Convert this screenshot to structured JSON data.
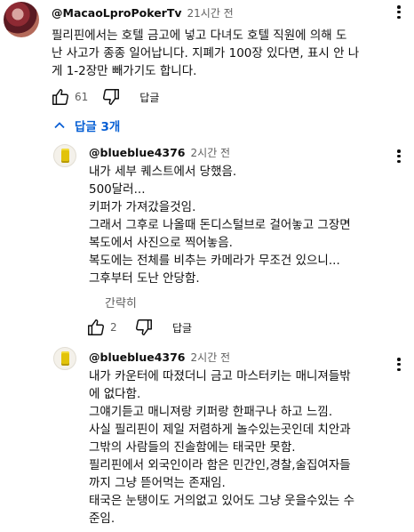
{
  "main_comment": {
    "author": "@MacaoLproPokerTv",
    "time": "21시간 전",
    "text": "필리핀에서는 호텔 금고에 넣고 다녀도 호텔 직원에 의해 도\n난 사고가 종종 일어납니다. 지폐가 100장 있다면, 표시 안 나\n게 1-2장만 빼가기도 합니다.",
    "likes": "61",
    "reply_label": "답글",
    "replies_toggle": "답글 3개"
  },
  "replies": [
    {
      "author": "@blueblue4376",
      "time": "2시간 전",
      "text": "내가 세부 퀘스트에서 당했음.\n500달러...\n키퍼가 가져갔을것임.\n그래서 그후로 나올때 돈디스털브로 걸어놓고 그장면\n복도에서 사진으로 찍어놓음.\n복도에는 전체를 비추는 카메라가 무조건 있으니...\n그후부터 도난 안당함.",
      "show_less": "간략히",
      "likes": "2",
      "reply_label": "답글"
    },
    {
      "author": "@blueblue4376",
      "time": "2시간 전",
      "text": "내가 카운터에 따졌더니 금고 마스터키는 매니져들밖\n에 없다함.\n그얘기듣고 매니져랑 키퍼랑 한패구나 하고 느낌.\n사실 필리핀이 제일 저렴하게 놀수있는곳인데 치안과\n그밖의 사람들의 진솔함에는 태국만 못함.\n필리핀에서 외국인이라 함은 민간인,경찰,술집여자들\n까지 그냥 뜯어먹는 존재임.\n태국은 눈탱이도 거의없고 있어도 그냥 웃을수있는 수\n준임."
    }
  ]
}
